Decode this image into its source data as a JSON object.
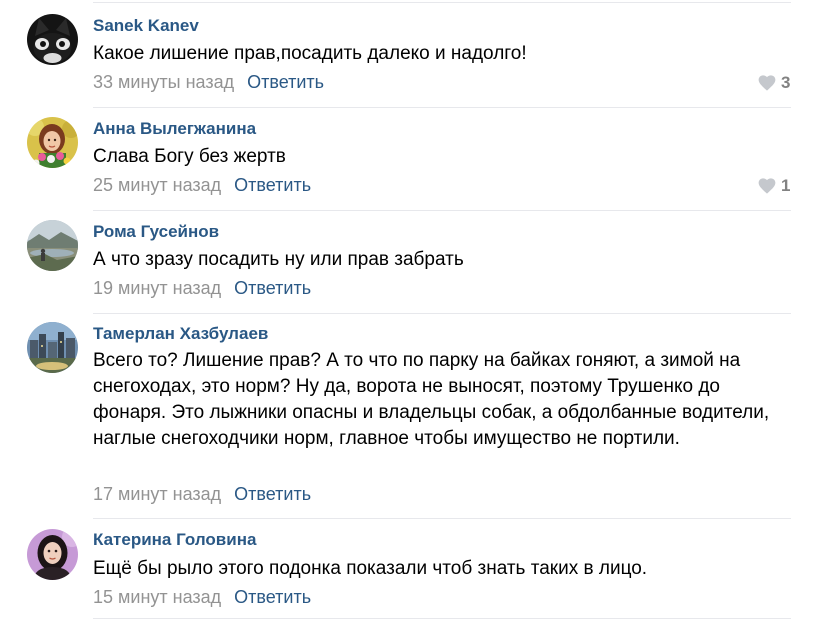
{
  "comments": [
    {
      "author": "Sanek Kanev",
      "text": "Какое лишение прав,посадить далеко и надолго!",
      "time": "33 минуты назад",
      "reply_label": "Ответить",
      "likes": "3",
      "avatar_icon": "cat-avatar-icon"
    },
    {
      "author": "Анна Вылегжанина",
      "text": "Слава Богу без жертв",
      "time": "25 минут назад",
      "reply_label": "Ответить",
      "likes": "1",
      "avatar_icon": "woman-flowers-avatar-icon"
    },
    {
      "author": "Рома Гусейнов",
      "text": "А что зразу посадить ну или прав забрать",
      "time": "19 минут назад",
      "reply_label": "Ответить",
      "avatar_icon": "landscape-avatar-icon"
    },
    {
      "author": "Тамерлан Хазбулаев",
      "text": "Всего то? Лишение прав? А то что по парку на байках гоняют, а зимой на снегоходах, это норм? Ну да, ворота не выносят, поэтому Трушенко до фонаря. Это лыжники опасны и владельцы собак, а обдолбанные водители, наглые снегоходчики норм, главное чтобы имущество не портили.",
      "time": "17 минут назад",
      "reply_label": "Ответить",
      "avatar_icon": "city-avatar-icon"
    },
    {
      "author": "Катерина Головина",
      "text": "Ещё бы рыло этого подонка показали чтоб знать таких в лицо.",
      "time": "15 минут назад",
      "reply_label": "Ответить",
      "avatar_icon": "woman-portrait-avatar-icon"
    }
  ],
  "colors": {
    "link": "#2a5885",
    "secondary_text": "#939393",
    "like_icon": "#c5c8cd",
    "like_count": "#828282",
    "divider": "#e7e8ec"
  }
}
